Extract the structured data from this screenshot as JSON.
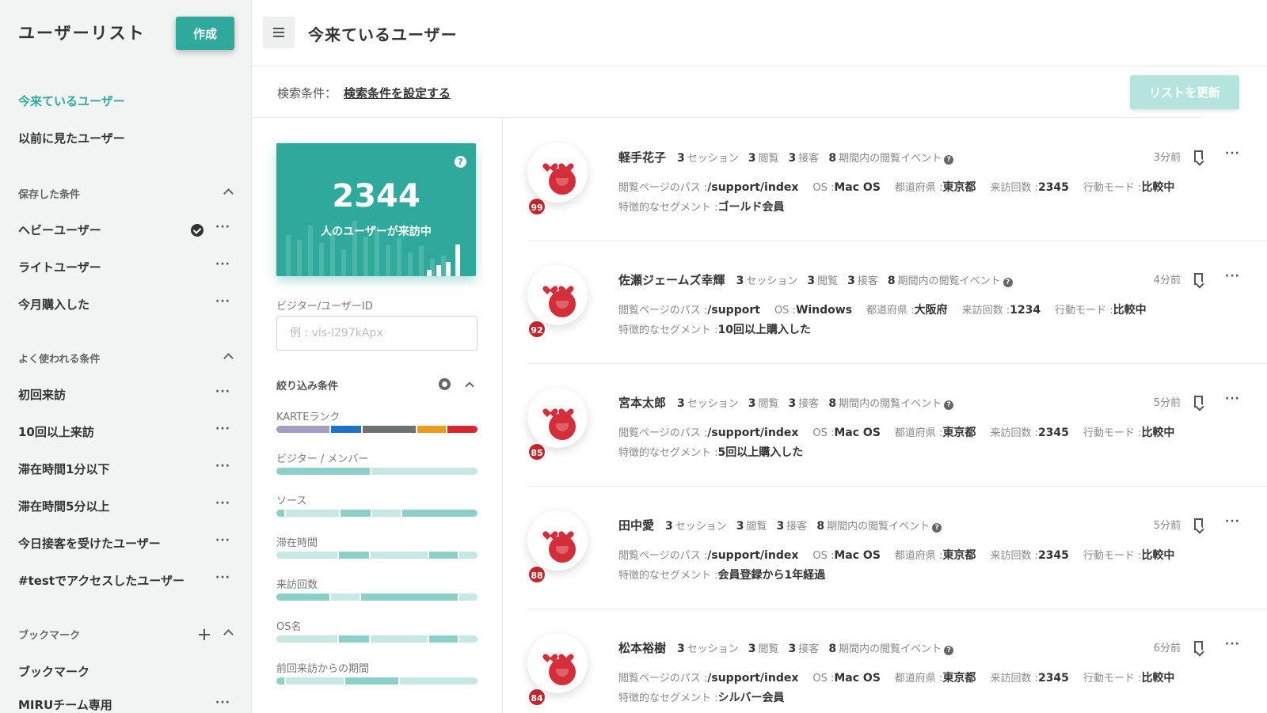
{
  "sidebar": {
    "title": "ユーザーリスト",
    "create_label": "作成",
    "nav": [
      {
        "label": "今来ているユーザー"
      },
      {
        "label": "以前に見たユーザー"
      }
    ],
    "saved_title": "保存した条件",
    "saved_items": [
      {
        "label": "ヘビーユーザー"
      },
      {
        "label": "ライトユーザー"
      },
      {
        "label": "今月購入した"
      }
    ],
    "frequent_title": "よく使われる条件",
    "frequent_items": [
      {
        "label": "初回来訪"
      },
      {
        "label": "10回以上来訪"
      },
      {
        "label": "滞在時間1分以下"
      },
      {
        "label": "滞在時間5分以上"
      },
      {
        "label": "今日接客を受けたユーザー"
      },
      {
        "label": "#testでアクセスしたユーザー"
      }
    ],
    "bookmark_title": "ブックマーク",
    "bookmark_items": [
      {
        "label": "ブックマーク"
      },
      {
        "label": "MIRUチーム専用"
      }
    ],
    "more": "···"
  },
  "header": {
    "title": "今来ているユーザー"
  },
  "condition": {
    "label": "検索条件：",
    "link": "検索条件を設定する",
    "update_label": "リストを更新"
  },
  "stats": {
    "count": "2344",
    "label": "人のユーザーが来訪中",
    "help": "?"
  },
  "filter": {
    "visitor_id_label": "ビジター/ユーザーID",
    "visitor_id_placeholder": "例 : vis-l297kApx",
    "narrow_title": "絞り込み条件",
    "items": [
      {
        "label": "KARTEランク",
        "segments": [
          {
            "share": 26,
            "color": "#a59cc4"
          },
          {
            "share": 15,
            "color": "#1e73c4"
          },
          {
            "share": 26,
            "color": "#6b7272"
          },
          {
            "share": 14,
            "color": "#eb9c1e"
          },
          {
            "share": 15,
            "color": "#d8282f"
          }
        ]
      },
      {
        "label": "ビジター / メンバー",
        "segments": [
          {
            "share": 47,
            "color": "#8cd0c9"
          },
          {
            "share": 53,
            "color": "#c6e8e4"
          }
        ]
      },
      {
        "label": "ソース",
        "segments": [
          {
            "share": 4,
            "color": "#8cd0c9"
          },
          {
            "share": 26,
            "color": "#c6e8e4"
          },
          {
            "share": 15,
            "color": "#8cd0c9"
          },
          {
            "share": 14,
            "color": "#c6e8e4"
          },
          {
            "share": 37,
            "color": "#8cd0c9"
          }
        ]
      },
      {
        "label": "滞在時間",
        "segments": [
          {
            "share": 30,
            "color": "#c6e8e4"
          },
          {
            "share": 15,
            "color": "#8cd0c9"
          },
          {
            "share": 28,
            "color": "#c6e8e4"
          },
          {
            "share": 14,
            "color": "#8cd0c9"
          },
          {
            "share": 9,
            "color": "#c6e8e4"
          }
        ]
      },
      {
        "label": "来訪回数",
        "segments": [
          {
            "share": 26,
            "color": "#8cd0c9"
          },
          {
            "share": 14,
            "color": "#c6e8e4"
          },
          {
            "share": 47,
            "color": "#8cd0c9"
          },
          {
            "share": 9,
            "color": "#c6e8e4"
          }
        ]
      },
      {
        "label": "OS名",
        "segments": [
          {
            "share": 30,
            "color": "#c6e8e4"
          },
          {
            "share": 15,
            "color": "#8cd0c9"
          },
          {
            "share": 28,
            "color": "#c6e8e4"
          },
          {
            "share": 14,
            "color": "#8cd0c9"
          },
          {
            "share": 9,
            "color": "#c6e8e4"
          }
        ]
      },
      {
        "label": "前回来訪からの期間",
        "segments": [
          {
            "share": 4,
            "color": "#8cd0c9"
          },
          {
            "share": 28,
            "color": "#c6e8e4"
          },
          {
            "share": 26,
            "color": "#8cd0c9"
          },
          {
            "share": 38,
            "color": "#c6e8e4"
          }
        ]
      }
    ]
  },
  "user_labels": {
    "session": "セッション",
    "view": "閲覧",
    "engage": "接客",
    "events": "期間内の閲覧イベント",
    "path": "閲覧ページのパス :",
    "os": "OS :",
    "pref": "都道府県 :",
    "visits": "来訪回数 :",
    "mode": "行動モード :",
    "segment": "特徴的なセグメント :"
  },
  "users": [
    {
      "name": "軽手花子",
      "sessions": "3",
      "views": "3",
      "engagements": "3",
      "events": "8",
      "time": "3分前",
      "path": "/support/index",
      "os": "Mac OS",
      "prefecture": "東京都",
      "visits": "2345",
      "mode": "比較中",
      "segment": "ゴールド会員",
      "score": "99"
    },
    {
      "name": "佐瀬ジェームズ幸輝",
      "sessions": "3",
      "views": "3",
      "engagements": "3",
      "events": "8",
      "time": "4分前",
      "path": "/support",
      "os": "Windows",
      "prefecture": "大阪府",
      "visits": "1234",
      "mode": "比較中",
      "segment": "10回以上購入した",
      "score": "92"
    },
    {
      "name": "宮本太郎",
      "sessions": "3",
      "views": "3",
      "engagements": "3",
      "events": "8",
      "time": "5分前",
      "path": "/support/index",
      "os": "Mac OS",
      "prefecture": "東京都",
      "visits": "2345",
      "mode": "比較中",
      "segment": "5回以上購入した",
      "score": "85"
    },
    {
      "name": "田中愛",
      "sessions": "3",
      "views": "3",
      "engagements": "3",
      "events": "8",
      "time": "5分前",
      "path": "/support/index",
      "os": "Mac OS",
      "prefecture": "東京都",
      "visits": "2345",
      "mode": "比較中",
      "segment": "会員登録から1年経過",
      "score": "88"
    },
    {
      "name": "松本裕樹",
      "sessions": "3",
      "views": "3",
      "engagements": "3",
      "events": "8",
      "time": "6分前",
      "path": "/support/index",
      "os": "Mac OS",
      "prefecture": "東京都",
      "visits": "2345",
      "mode": "比較中",
      "segment": "シルバー会員",
      "score": "84"
    }
  ]
}
